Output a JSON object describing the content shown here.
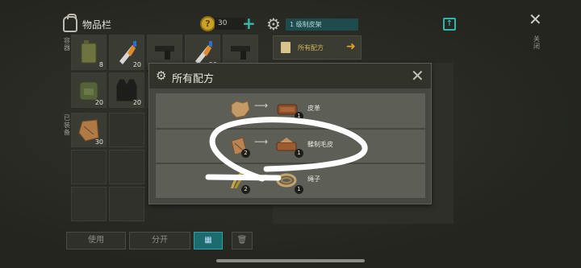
{
  "inventory": {
    "title": "物品栏",
    "coin_symbol": "?",
    "coin_count": "30",
    "add_label": "+",
    "side_label_top": "容器",
    "side_label_bottom": "已装备",
    "slots_row1": [
      {
        "icon": "jerrycan-icon",
        "qty": "8"
      },
      {
        "icon": "glue-tube-icon",
        "qty": "20"
      },
      {
        "icon": "pistol-icon",
        "qty": ""
      },
      {
        "icon": "glue-tube-icon",
        "qty": "20"
      },
      {
        "icon": "pistol-icon",
        "qty": ""
      }
    ],
    "slots_row2": [
      {
        "icon": "backpack-item-icon",
        "qty": "20"
      },
      {
        "icon": "vest-icon",
        "qty": "20"
      }
    ],
    "slots_row3": [
      {
        "icon": "hide-item-icon",
        "qty": "30"
      }
    ],
    "buttons": {
      "use": "使用",
      "split": "分开",
      "grid": "▦",
      "trash": "🗑"
    }
  },
  "crafting": {
    "bench_name": "1 级制皮架",
    "recipes_tab": "所有配方",
    "close_label": "关闭"
  },
  "modal": {
    "title": "所有配方",
    "close": "✕",
    "recipes": [
      {
        "name": "皮革",
        "input_qty": "",
        "output_qty": "1",
        "input_icon": "raw-hide-icon",
        "output_icon": "leather-icon"
      },
      {
        "name": "鞣制毛皮",
        "input_qty": "2",
        "output_qty": "1",
        "input_icon": "fur-scrap-icon",
        "output_icon": "tanned-fur-icon"
      },
      {
        "name": "绳子",
        "input_qty": "2",
        "output_qty": "1",
        "input_icon": "fiber-icon",
        "output_icon": "rope-icon"
      }
    ]
  },
  "colors": {
    "accent": "#2fb6ad",
    "gold": "#e1a325"
  }
}
